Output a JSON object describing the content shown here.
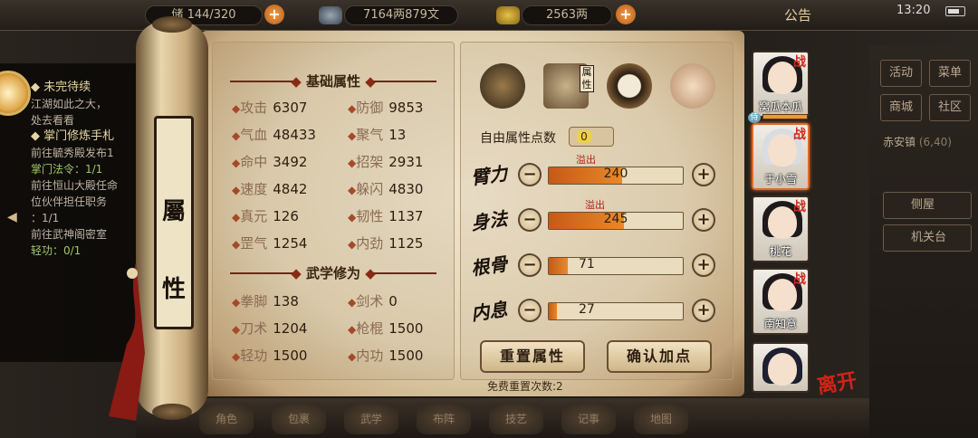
{
  "top_bar": {
    "storage_label": "储",
    "storage_value": "144/320",
    "money_value": "7164两879文",
    "gold_value": "2563两",
    "notice_label": "公告",
    "time": "13:20"
  },
  "quest_panel": {
    "unfinished_title": "未完待续",
    "unfinished_lines": [
      "江湖如此之大，",
      "处去看看"
    ],
    "sect_title": "掌门修炼手札",
    "sect_lines": [
      "前往毓秀殿发布1",
      "掌门法令：1/1",
      "前往恒山大殿任命",
      "位伙伴担任职务",
      "：1/1",
      "前往武神阁密室",
      "轻功：0/1"
    ]
  },
  "scroll_label": {
    "title_top": "屬",
    "title_bottom": "性"
  },
  "basic_attrs": {
    "title": "基础属性",
    "items": [
      {
        "label": "攻击",
        "value": "6307"
      },
      {
        "label": "防御",
        "value": "9853"
      },
      {
        "label": "气血",
        "value": "48433"
      },
      {
        "label": "聚气",
        "value": "13"
      },
      {
        "label": "命中",
        "value": "3492"
      },
      {
        "label": "招架",
        "value": "2931"
      },
      {
        "label": "速度",
        "value": "4842"
      },
      {
        "label": "躲闪",
        "value": "4830"
      },
      {
        "label": "真元",
        "value": "126"
      },
      {
        "label": "韧性",
        "value": "1137"
      },
      {
        "label": "罡气",
        "value": "1254"
      },
      {
        "label": "内劲",
        "value": "1125"
      }
    ]
  },
  "martial_skills": {
    "title": "武学修为",
    "items": [
      {
        "label": "拳脚",
        "value": "138"
      },
      {
        "label": "剑术",
        "value": "0"
      },
      {
        "label": "刀术",
        "value": "1204"
      },
      {
        "label": "枪棍",
        "value": "1500"
      },
      {
        "label": "轻功",
        "value": "1500"
      },
      {
        "label": "内功",
        "value": "1500"
      }
    ]
  },
  "attr_tabs": {
    "active_tab_label": "属性"
  },
  "free_points": {
    "label": "自由属性点数",
    "value": "0"
  },
  "allocation": [
    {
      "name": "臂力",
      "value": "240",
      "fill": 0.55,
      "overflow_label": "溢出"
    },
    {
      "name": "身法",
      "value": "245",
      "fill": 0.56,
      "overflow_label": "溢出"
    },
    {
      "name": "根骨",
      "value": "71",
      "fill": 0.14
    },
    {
      "name": "内息",
      "value": "27",
      "fill": 0.06
    }
  ],
  "buttons": {
    "reset": "重置属性",
    "confirm": "确认加点"
  },
  "reset_note": "免费重置次数:2",
  "characters": [
    {
      "name": "窝瓜本瓜",
      "tag": "战",
      "badge": "侍"
    },
    {
      "name": "于小雪",
      "tag": "战"
    },
    {
      "name": "桃花",
      "tag": "战"
    },
    {
      "name": "南知意",
      "tag": "战"
    },
    {
      "name": ""
    }
  ],
  "leave_label": "离开",
  "right_menu": {
    "buttons": [
      "活动",
      "菜单",
      "商城",
      "社区"
    ],
    "location": "赤安镇",
    "coords": "(6,40)",
    "rooms": [
      "侧屋",
      "机关台"
    ]
  },
  "bottom_menu": [
    "角色",
    "包裹",
    "武学",
    "布阵",
    "技艺",
    "记事",
    "地图"
  ],
  "colors": {
    "accent": "#c55a18",
    "overflow": "#b0211a",
    "title": "#8b2a14"
  }
}
